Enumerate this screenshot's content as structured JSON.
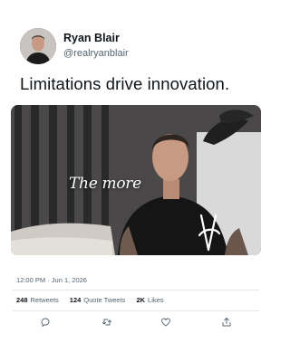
{
  "author": {
    "name": "Ryan Blair",
    "handle": "@realryanblair"
  },
  "tweet": {
    "text": "Limitations drive innovation.",
    "media_caption": "The more",
    "timestamp": "12:00 PM · Jun 1, 2026"
  },
  "stats": {
    "retweets_count": "248",
    "retweets_label": "Retweets",
    "quotes_count": "124",
    "quotes_label": "Quote Tweets",
    "likes_count": "2K",
    "likes_label": "Likes"
  },
  "actions": {
    "icons": [
      "reply-icon",
      "retweet-icon",
      "like-icon",
      "share-icon"
    ]
  },
  "colors": {
    "text_primary": "#0f1419",
    "text_secondary": "#536471",
    "divider": "#e6e9ec",
    "icon": "#536471"
  }
}
